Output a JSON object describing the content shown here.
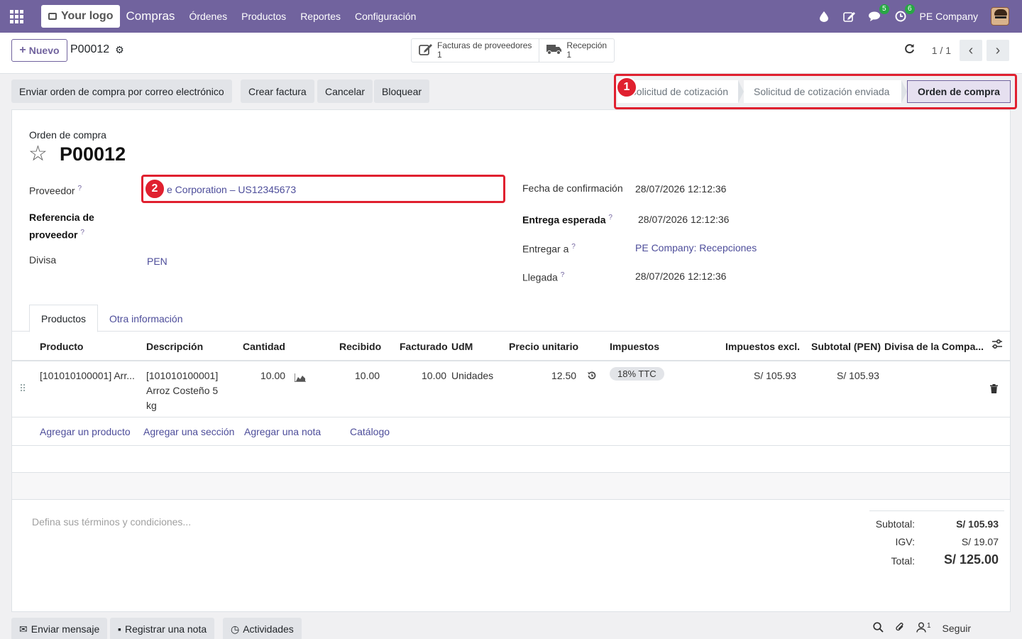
{
  "navbar": {
    "logo": "Your logo",
    "app": "Compras",
    "menu": [
      "Órdenes",
      "Productos",
      "Reportes",
      "Configuración"
    ],
    "chat_badge": "5",
    "activity_badge": "6",
    "company": "PE Company"
  },
  "control": {
    "new_label": "Nuevo",
    "record": "P00012",
    "smart_buttons": [
      {
        "label": "Facturas de proveedores",
        "count": "1"
      },
      {
        "label": "Recepción",
        "count": "1"
      }
    ],
    "pager": "1 / 1"
  },
  "actions": [
    "Enviar orden de compra por correo electrónico",
    "Crear factura",
    "Cancelar",
    "Bloquear"
  ],
  "stages": [
    "Solicitud de cotización",
    "Solicitud de cotización enviada",
    "Orden de compra"
  ],
  "markers": [
    "1",
    "2"
  ],
  "form": {
    "doc_type": "Orden de compra",
    "name": "P00012",
    "proveedor_label": "Proveedor",
    "proveedor_value": "e Corporation – US12345673",
    "referencia_label": "Referencia de proveedor",
    "divisa_label": "Divisa",
    "divisa_value": "PEN",
    "fecha_conf_label": "Fecha de confirmación",
    "fecha_conf_value": "28/07/2026 12:12:36",
    "entrega_esp_label": "Entrega esperada",
    "entrega_esp_value": "28/07/2026 12:12:36",
    "entregar_label": "Entregar a",
    "entregar_value": "PE Company: Recepciones",
    "llegada_label": "Llegada",
    "llegada_value": "28/07/2026 12:12:36",
    "help_mark": "?"
  },
  "tabs": [
    "Productos",
    "Otra información"
  ],
  "table": {
    "headers": [
      "Producto",
      "Descripción",
      "Cantidad",
      "Recibido",
      "Facturado",
      "UdM",
      "Precio unitario",
      "Impuestos",
      "Impuestos excl.",
      "Subtotal (PEN)",
      "Divisa de la Compa..."
    ],
    "row": {
      "producto": "[101010100001] Arr...",
      "descripcion": [
        "[101010100001]",
        "Arroz Costeño 5",
        "kg"
      ],
      "cantidad": "10.00",
      "recibido": "10.00",
      "facturado": "10.00",
      "udm": "Unidades",
      "precio": "12.50",
      "impuesto": "18% TTC",
      "impuestos_excl": "S/ 105.93",
      "subtotal": "S/ 105.93"
    },
    "add_links": [
      "Agregar un producto",
      "Agregar una sección",
      "Agregar una nota",
      "Catálogo"
    ]
  },
  "terms_placeholder": "Defina sus términos y condiciones...",
  "totals": {
    "subtotal_label": "Subtotal:",
    "subtotal_value": "S/ 105.93",
    "igv_label": "IGV:",
    "igv_value": "S/ 19.07",
    "total_label": "Total:",
    "total_value": "S/ 125.00"
  },
  "chatter": {
    "send_message": "Enviar mensaje",
    "log_note": "Registrar una nota",
    "activities": "Actividades",
    "followers": "1",
    "follow": "Seguir"
  },
  "colors": {
    "brand": "#71639e",
    "highlight": "#e0202f",
    "badge": "#28a745"
  }
}
